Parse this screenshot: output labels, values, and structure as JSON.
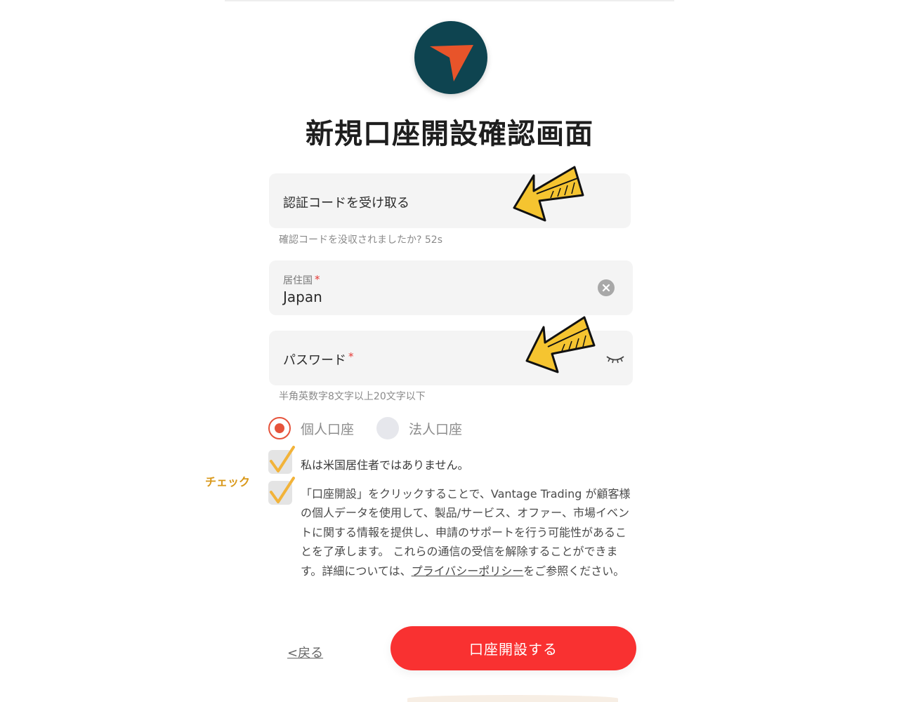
{
  "app": {
    "title": "新規口座開設確認画面",
    "accent_color": "#f93131",
    "logo_bg_color": "#0e4450",
    "logo_mark_color": "#e8542a"
  },
  "code_field": {
    "label": "認証コードを受け取る",
    "hint": "確認コードを没収されましたか? 52s"
  },
  "country_field": {
    "label": "居住国",
    "required_mark": "*",
    "value": "Japan",
    "clear_icon": "clear-circle-icon"
  },
  "password_field": {
    "label": "パスワード",
    "required_mark": "*",
    "hint": "半角英数字8文字以上20文字以下",
    "visibility_icon": "eye-closed-icon"
  },
  "account_type": {
    "options": [
      {
        "label": "個人口座",
        "selected": true
      },
      {
        "label": "法人口座",
        "selected": false
      }
    ]
  },
  "checks": {
    "us_resident": {
      "label": "私は米国居住者ではありません。",
      "checked": true
    },
    "consent": {
      "text": "「口座開設」をクリックすることで、Vantage Trading が顧客様の個人データを使用して、製品/サービス、オファー、市場イベントに関する情報を提供し、申請のサポートを行う可能性があることを了承します。 これらの通信の受信を解除することができます。詳細については、",
      "link": "プライバシーポリシー",
      "suffix": "をご参照ください。",
      "checked": true
    }
  },
  "annotation": {
    "text": "チェック",
    "color": "#d9981a"
  },
  "actions": {
    "back_label": "<戻る",
    "submit_label": "口座開設する"
  }
}
